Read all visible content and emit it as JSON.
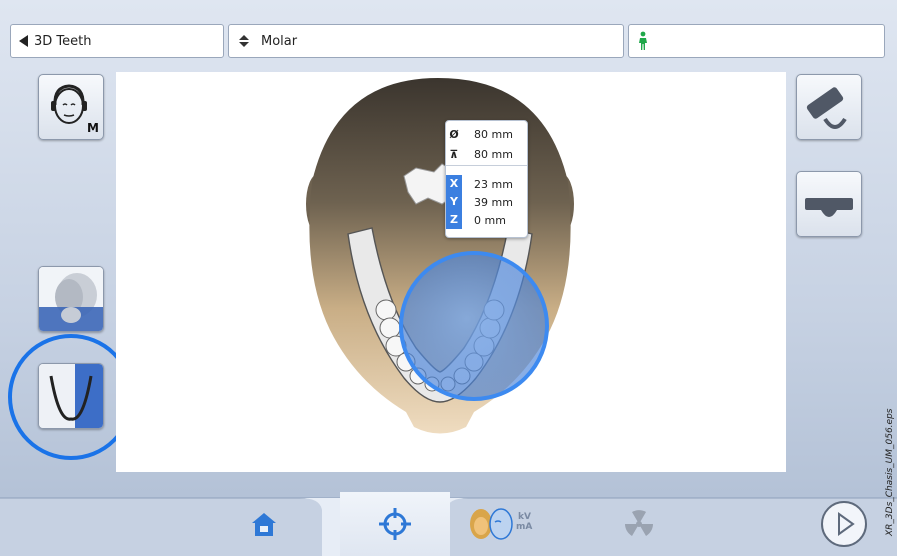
{
  "topbar": {
    "back_label": "3D Teeth",
    "program_label": "Molar",
    "patient_label": ""
  },
  "measurements": {
    "diameter": "80 mm",
    "height": "80 mm",
    "x_label": "X",
    "x_value": "23 mm",
    "y_label": "Y",
    "y_value": "39 mm",
    "z_label": "Z",
    "z_value": "0 mm"
  },
  "left_buttons": {
    "head_size_badge": "M"
  },
  "bottom_tabs": {
    "kv_label": "kV",
    "ma_label": "mA"
  },
  "side_text": "XR_3Ds_Chasis_UM_056.eps",
  "colors": {
    "accent": "#1a73e8",
    "axis_label_bg": "#3b7fe0",
    "patient_icon": "#1fa84a"
  }
}
